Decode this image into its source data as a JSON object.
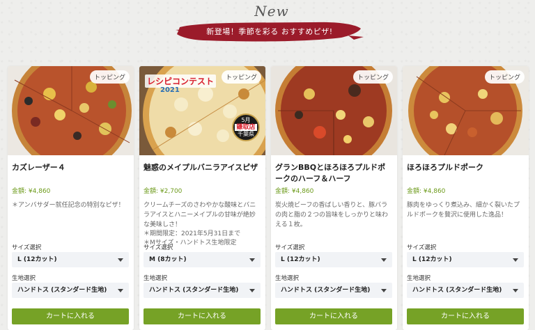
{
  "banner": {
    "new_label": "New",
    "headline": "新登場！季節を彩る おすすめピザ!",
    "brush_color": "#9b1b2a"
  },
  "common": {
    "size_label": "サイズ選択",
    "crust_label": "生地選択",
    "cart_button": "カートに入れる",
    "topping_badge": "トッピング",
    "price_prefix": "金額: "
  },
  "products": [
    {
      "name": "カズレーザー４",
      "price": "¥4,860",
      "description": "＊アンバサダー就任記念の特別なピザ！",
      "notes": [],
      "size": "L (12カット)",
      "crust": "ハンドトス (スタンダード生地)"
    },
    {
      "name": "魅惑のメイプルバニラアイスピザ",
      "price": "¥2,700",
      "description": "クリームチーズのさわやかな酸味とバニラアイスとハニーメイプルの甘味が絶妙な美味しさ！",
      "notes": [
        "＊期間限定：2021年5月31日まで",
        "＊Mサイズ・ハンドトス生地限定"
      ],
      "size": "M (8カット)",
      "crust": "ハンドトス (スタンダード生地)",
      "contest_logo": "レシピコンテスト",
      "contest_year": "2021",
      "seal_top": "5月",
      "seal_mid": "鎌取店",
      "seal_bottom": "千葉県"
    },
    {
      "name": "グランBBQとほろほろプルドポークのハーフ＆ハーフ",
      "price": "¥4,860",
      "description": "炭火焼ビーフの香ばしい香りと、豚バラの肉と脂の２つの旨味をしっかりと味わえる１枚。",
      "notes": [],
      "size": "L (12カット)",
      "crust": "ハンドトス (スタンダード生地)"
    },
    {
      "name": "ほろほろプルドポーク",
      "price": "¥4,860",
      "description": "豚肉をゆっくり煮込み、細かく裂いたプルドポークを贅沢に使用した逸品！",
      "notes": [],
      "size": "L (12カット)",
      "crust": "ハンドトス (スタンダード生地)"
    }
  ],
  "colors": {
    "accent_green": "#76a226",
    "price_green": "#6c9a1a",
    "select_bg": "#f1f3f6"
  }
}
